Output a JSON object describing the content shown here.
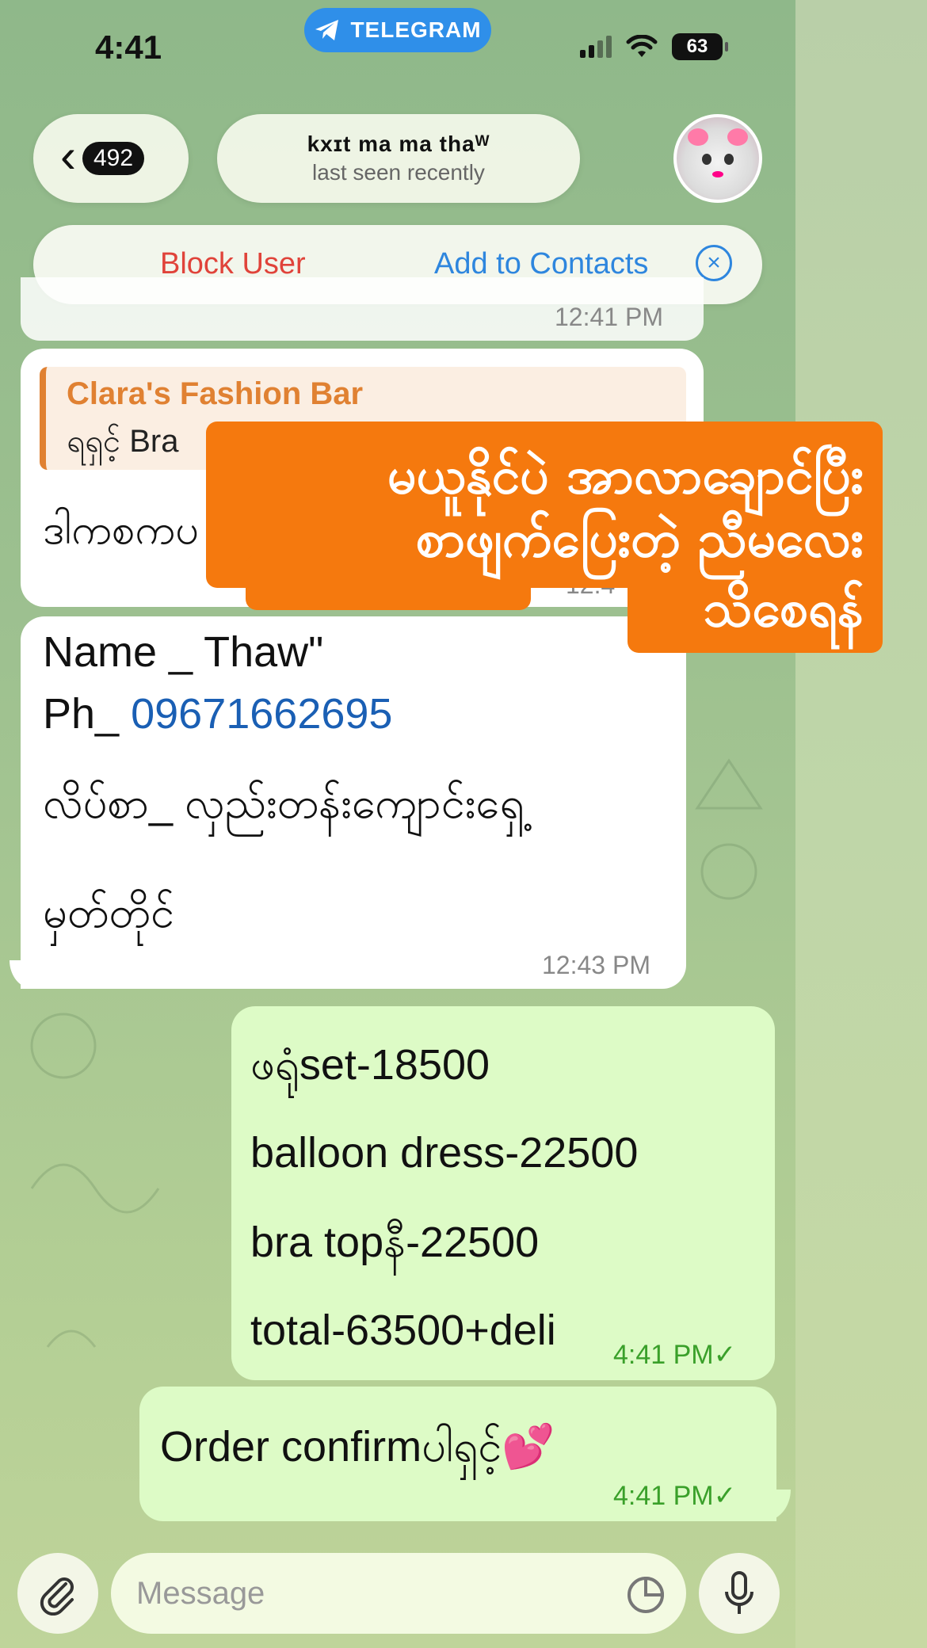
{
  "status_bar": {
    "time": "4:41",
    "app_pill": "TELEGRAM",
    "battery": "63"
  },
  "header": {
    "unread_count": "492",
    "contact_name": "kxɪt ma ma thaᵂ",
    "contact_status": "last seen recently"
  },
  "action_bar": {
    "block": "Block User",
    "add": "Add to Contacts"
  },
  "messages": {
    "top_time": "12:41 PM",
    "reply_msg": {
      "reply_name": "Clara's Fashion Bar",
      "reply_text": "ရရှင့် Bra",
      "text": "ဒါကစကပ",
      "time": "12:4"
    },
    "address_msg": {
      "line1": "Name _ Thaw\"",
      "line2_prefix": "Ph_ ",
      "phone": "09671662695",
      "line3": "လိပ်စာ_ လှည်းတန်းကျောင်းရှေ့",
      "line4": "မှတ်တိုင်",
      "time": "12:43 PM"
    },
    "order_msg": {
      "line1": "ဖရုံset-18500",
      "line2": "balloon dress-22500",
      "line3": "bra topနီ-22500",
      "line4": "total-63500+deli",
      "time": "4:41 PM"
    },
    "confirm_msg": {
      "text": "Order confirmပါရှင့်💕",
      "time": "4:41 PM"
    }
  },
  "overlay": {
    "line1": "မယူနိုင်ပဲ အာလာချောင်ပြီး",
    "line2": "စာဖျက်ပြေးတဲ့ ညီမလေး",
    "line3": "သိစေရန်"
  },
  "composer": {
    "placeholder": "Message"
  }
}
